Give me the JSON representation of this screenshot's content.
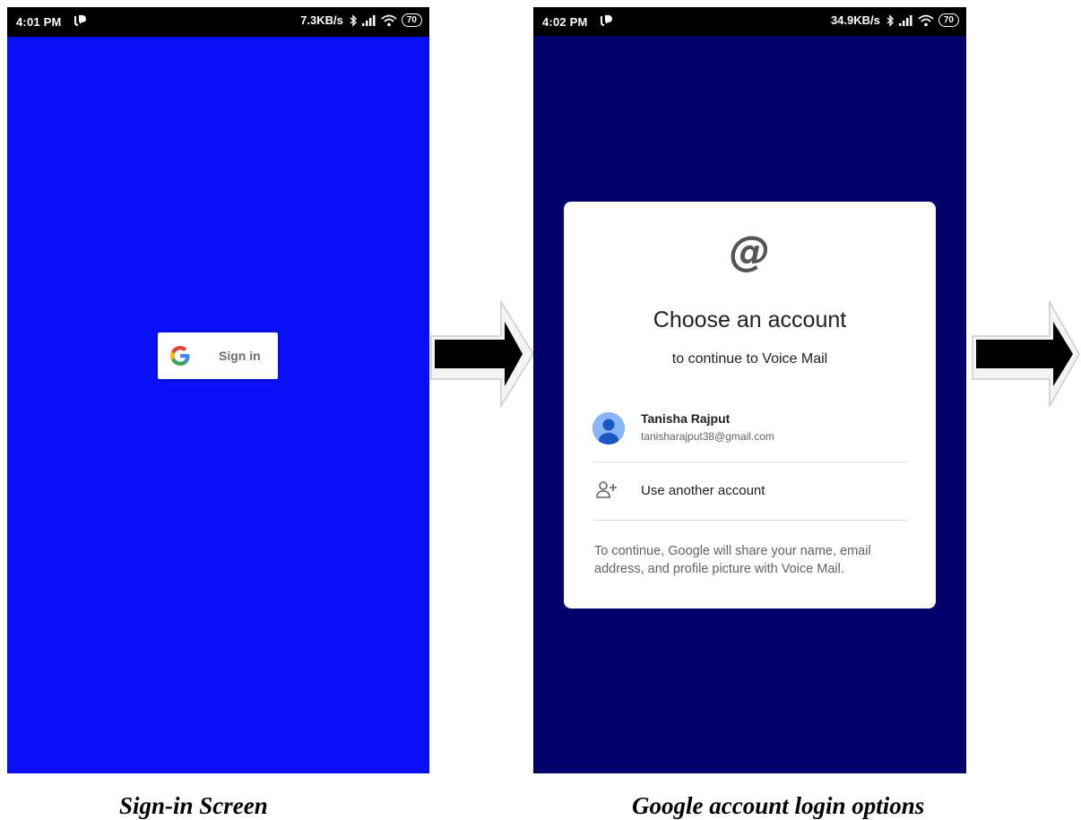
{
  "screen1": {
    "status_bar": {
      "time": "4:01 PM",
      "network_speed": "7.3KB/s",
      "battery": "70"
    },
    "signin_button": {
      "label": "Sign in",
      "icon": "google-g-icon"
    },
    "background_color": "#0a10f5",
    "caption": "Sign-in Screen"
  },
  "screen2": {
    "status_bar": {
      "time": "4:02 PM",
      "network_speed": "34.9KB/s",
      "battery": "70"
    },
    "background_color": "#02006a",
    "dialog": {
      "icon": "@",
      "title": "Choose an account",
      "subtitle": "to continue to Voice Mail",
      "account": {
        "name": "Tanisha Rajput",
        "email": "tanisharajput38@gmail.com"
      },
      "another_account_label": "Use another account",
      "disclaimer": "To continue, Google will share your name, email address, and profile picture with Voice Mail."
    },
    "caption": "Google account login options"
  },
  "icons": {
    "notification": "notification-icon",
    "bluetooth": "bluetooth-icon",
    "signal": "signal-icon",
    "wifi": "wifi-icon",
    "battery": "battery-icon",
    "add_person": "add-person-icon",
    "flow_arrow": "arrow-right-icon"
  }
}
